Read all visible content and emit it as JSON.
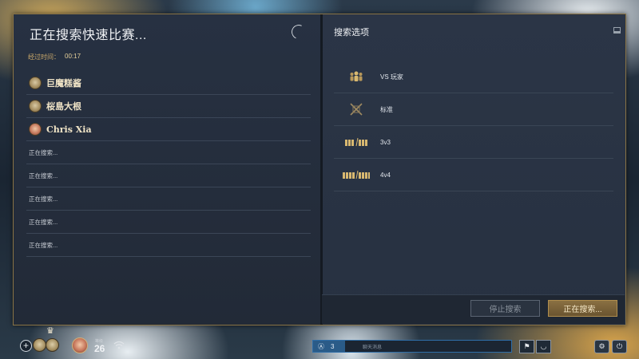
{
  "search_panel": {
    "title": "正在搜索快速比赛...",
    "elapsed_label": "经过时间：",
    "elapsed_value": "00:17",
    "players": [
      {
        "name": "巨魔糕酱",
        "avatar": "gold"
      },
      {
        "name": "桜島大根",
        "avatar": "gold"
      },
      {
        "name": "Chris Xia",
        "avatar": "red"
      }
    ],
    "searching_slots": [
      "正在搜索...",
      "正在搜索...",
      "正在搜索...",
      "正在搜索...",
      "正在搜索..."
    ]
  },
  "options_panel": {
    "title": "搜索选项",
    "options": [
      {
        "icon": "players-icon",
        "label": "VS 玩家"
      },
      {
        "icon": "crossed-swords-icon",
        "label": "标准"
      },
      {
        "icon": "team-3v3-icon",
        "label": "3v3"
      },
      {
        "icon": "team-4v4-icon",
        "label": "4v4"
      }
    ]
  },
  "buttons": {
    "stop_label": "停止搜索",
    "searching_label": "正在搜索..."
  },
  "hud": {
    "level_label": "等级",
    "level": "26",
    "chat_count": "3",
    "chat_placeholder": "聊天消息"
  },
  "colors": {
    "accent_gold": "#c9a86a",
    "panel_bg": "#273142",
    "chat_blue": "#2a5b88"
  }
}
